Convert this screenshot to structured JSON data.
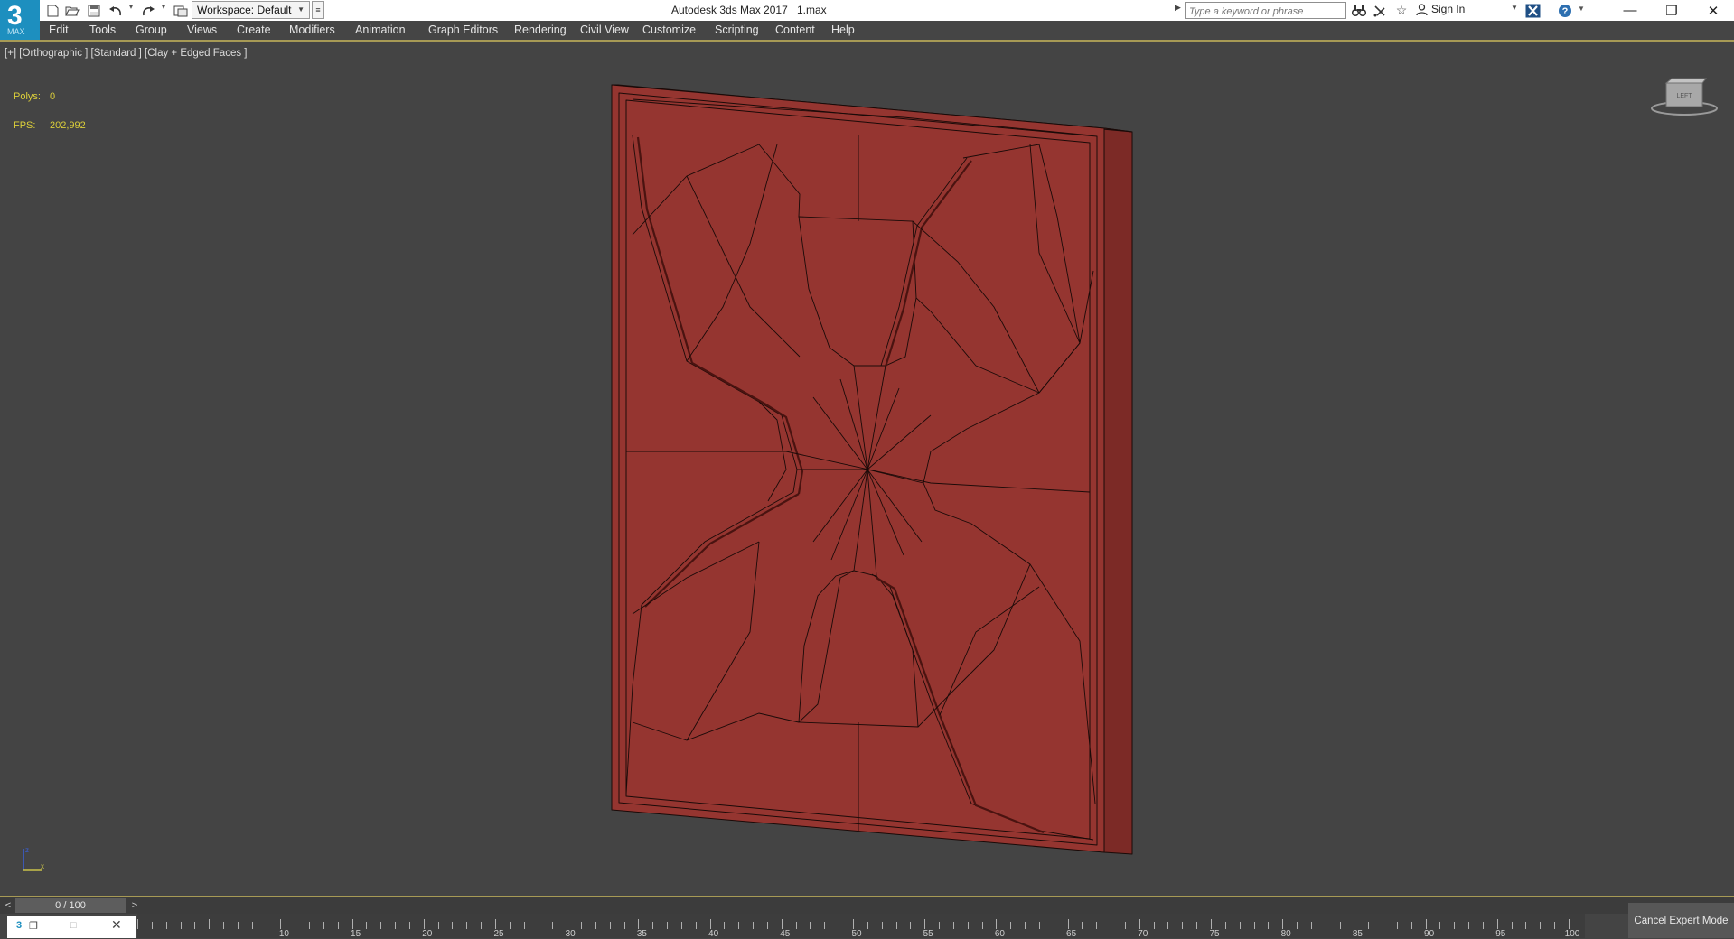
{
  "title_bar": {
    "logo_glyph": "3",
    "logo_sub": "MAX",
    "workspace_label": "Workspace: Default",
    "app_title": "Autodesk 3ds Max 2017",
    "file_name": "1.max",
    "search_placeholder": "Type a keyword or phrase",
    "sign_in_label": "Sign In",
    "icons": [
      "new-file-icon",
      "open-file-icon",
      "save-icon",
      "undo-icon",
      "redo-icon",
      "project-folder-icon",
      "binoculars-icon",
      "satellite-icon",
      "star-icon",
      "user-icon",
      "exchange-icon",
      "help-icon"
    ],
    "window_controls": {
      "minimize": "—",
      "restore": "❐",
      "close": "✕"
    }
  },
  "menu": {
    "items": [
      "Edit",
      "Tools",
      "Group",
      "Views",
      "Create",
      "Modifiers",
      "Animation",
      "Graph Editors",
      "Rendering",
      "Civil View",
      "Customize",
      "Scripting",
      "Content",
      "Help"
    ]
  },
  "viewport": {
    "label": "[+] [Orthographic ] [Standard ] [Clay + Edged Faces ]",
    "stats": [
      {
        "label": "Polys:",
        "value": "0"
      },
      {
        "label": "FPS:",
        "value": "202,992"
      }
    ],
    "viewcube_face": "LEFT",
    "model_color": "#953530",
    "axis_labels": {
      "z": "z",
      "x": "x"
    }
  },
  "timeline": {
    "slider_text": "0 / 100",
    "prev_label": "<",
    "next_label": ">",
    "ruler_labels": [
      "10",
      "15",
      "20",
      "25",
      "30",
      "35",
      "40",
      "45",
      "50",
      "55",
      "60",
      "65",
      "70",
      "75",
      "80",
      "85",
      "90",
      "95",
      "100"
    ],
    "cancel_expert_label": "Cancel Expert Mode"
  },
  "colors": {
    "accent_border": "#a79a55",
    "stats_text": "#dccf3a",
    "logo_bg": "#1d8fbf"
  }
}
